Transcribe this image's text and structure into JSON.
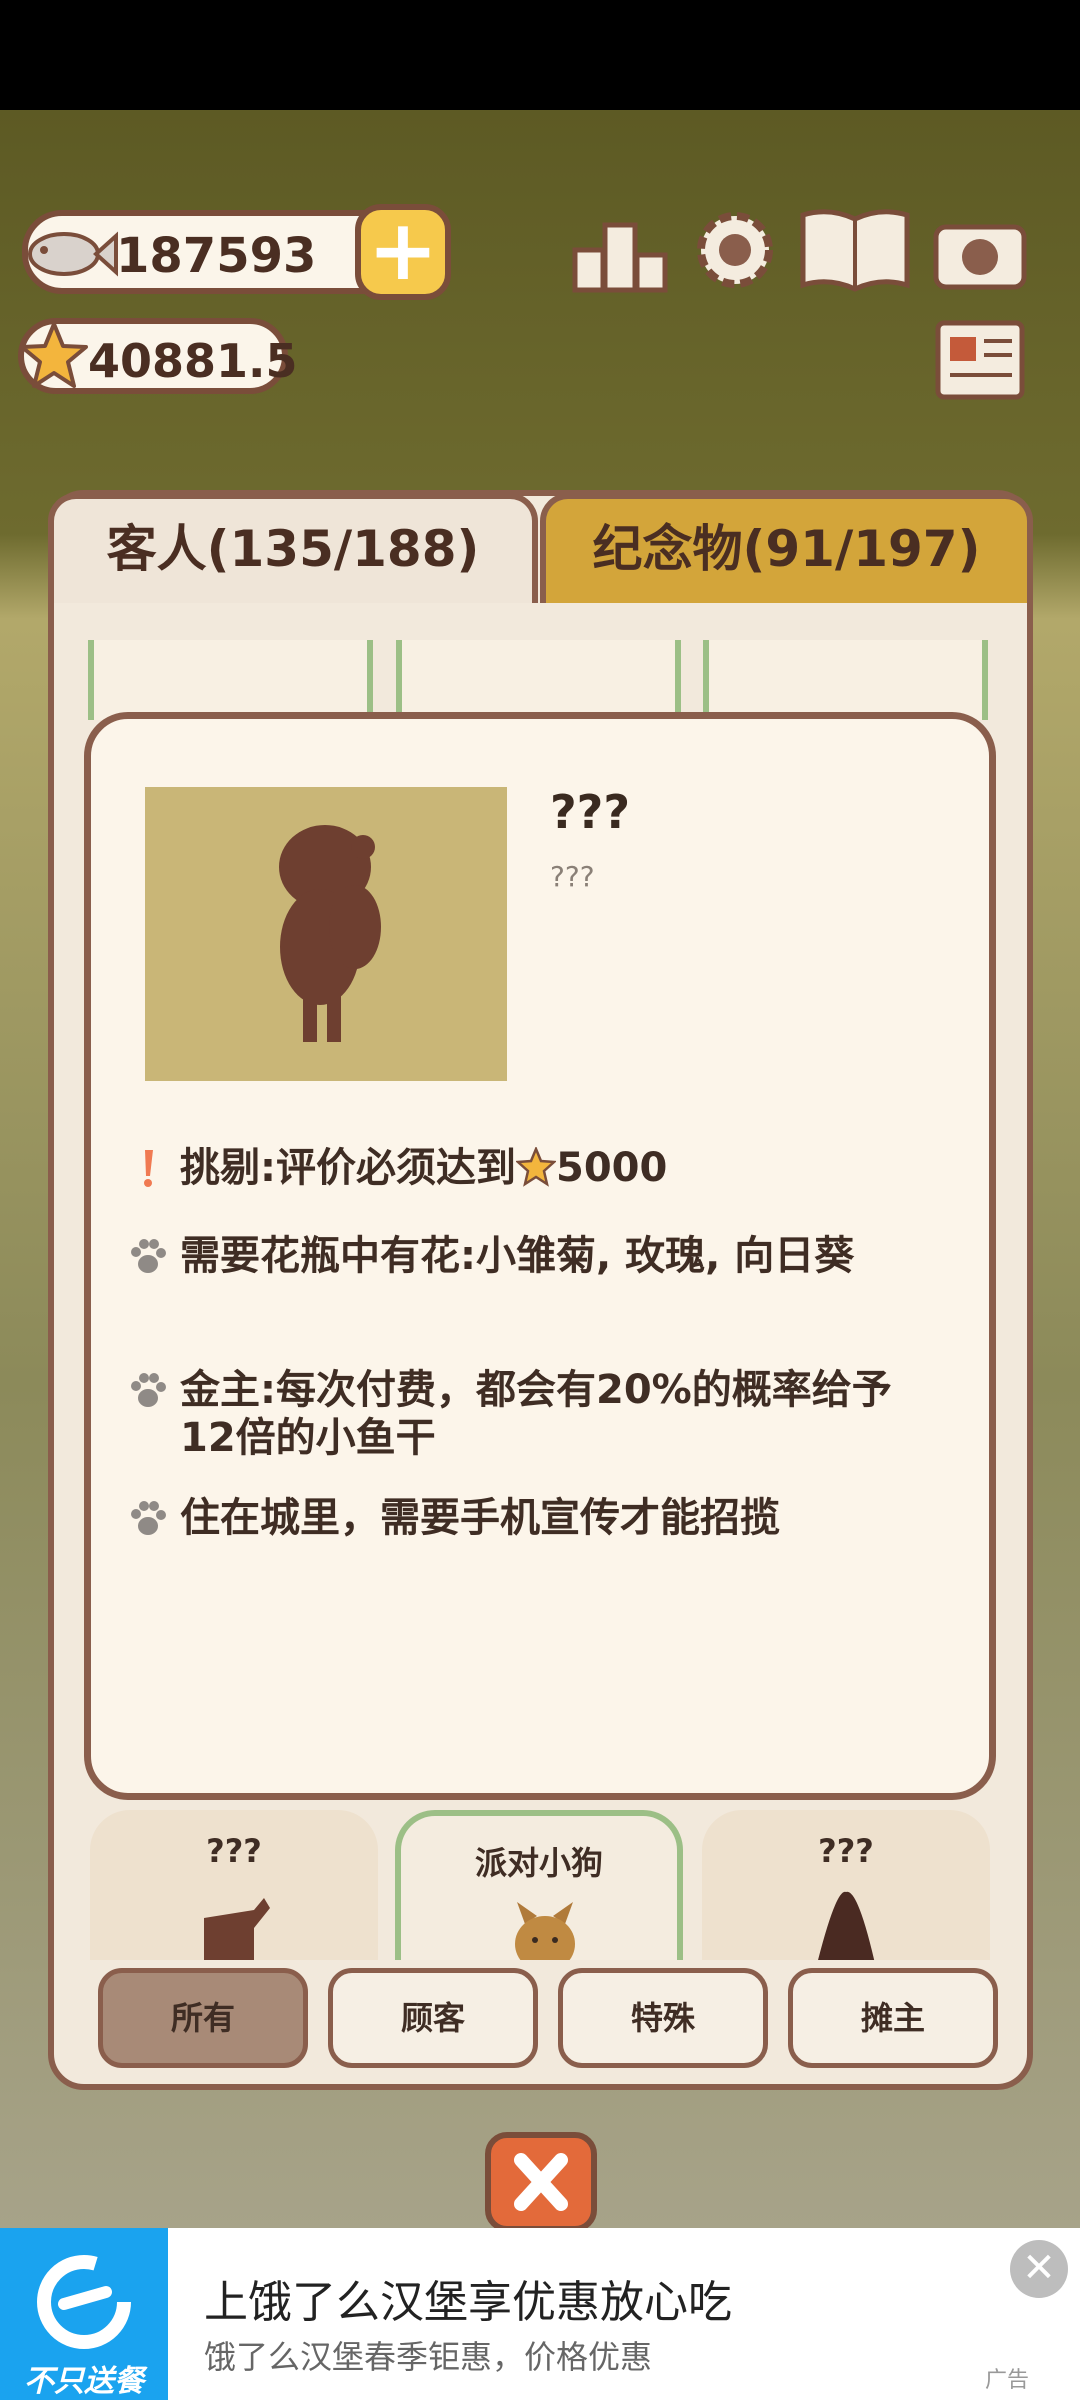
{
  "hud": {
    "fish_count": "187593",
    "star_count": "40881.5"
  },
  "tabs": {
    "guests": "客人(135/188)",
    "souvenirs": "纪念物(91/197)"
  },
  "detail": {
    "name": "???",
    "subtitle": "???",
    "traits": [
      {
        "icon": "exclamation-icon",
        "text_before": "挑剔:评价必须达到",
        "star": true,
        "text_after": "5000"
      },
      {
        "icon": "paw-icon",
        "text": "需要花瓶中有花:小雏菊, 玫瑰, 向日葵"
      },
      {
        "icon": "paw-icon",
        "text": "金主:每次付费，都会有20%的概率给予12倍的小鱼干"
      },
      {
        "icon": "paw-icon",
        "text": "住在城里，需要手机宣传才能招揽"
      }
    ]
  },
  "guest_cards": [
    {
      "label": "???"
    },
    {
      "label": "派对小狗"
    },
    {
      "label": "???"
    }
  ],
  "filters": {
    "all": "所有",
    "customers": "顾客",
    "special": "特殊",
    "vendors": "摊主"
  },
  "ad": {
    "logo_text": "不只送餐",
    "title": "上饿了么汉堡享优惠放心吃",
    "subtitle": "饿了么汉堡春季钜惠，价格优惠",
    "tag": "广告",
    "close": "✕"
  },
  "colors": {
    "panel_border": "#8a5e4c",
    "tab_active": "#d3a53a",
    "accent_green": "#9cbf86",
    "ad_blue": "#1aa3ef"
  }
}
